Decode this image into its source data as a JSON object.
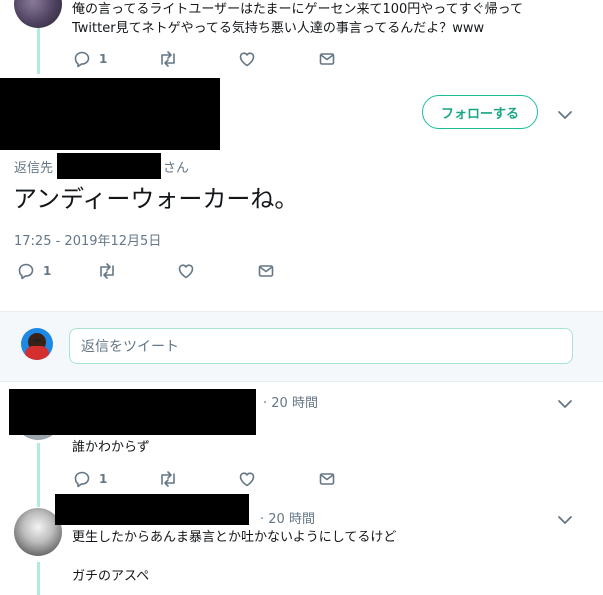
{
  "top_tweet": {
    "line1": "俺の言ってるライトユーザーはたまーにゲーセン来て100円やってすぐ帰って",
    "line2": "Twitter見てネトゲやってる気持ち悪い人達の事言ってるんだよ？www",
    "reply_count": "1"
  },
  "main_tweet": {
    "follow_label": "フォローする",
    "reply_to_prefix": "返信先",
    "reply_to_suffix": "さん",
    "text": "アンディーウォーカーね。",
    "timestamp": "17:25 - 2019年12月5日",
    "reply_count": "1"
  },
  "reply_box": {
    "placeholder": "返信をツイート"
  },
  "replies": [
    {
      "time": "· 20 時間",
      "text": "誰かわからず",
      "reply_count": "1"
    },
    {
      "time": "· 20 時間",
      "text_line1": "更生したからあんま暴言とか吐かないようにしてるけど",
      "text_line2": "ガチのアスペ"
    }
  ],
  "icons": [
    "reply-icon",
    "retweet-icon",
    "like-icon",
    "dm-icon",
    "chevron-down-icon"
  ],
  "colors": {
    "accent": "#1dbf9b",
    "thread_line": "#b2ecd9",
    "muted": "#657786"
  }
}
